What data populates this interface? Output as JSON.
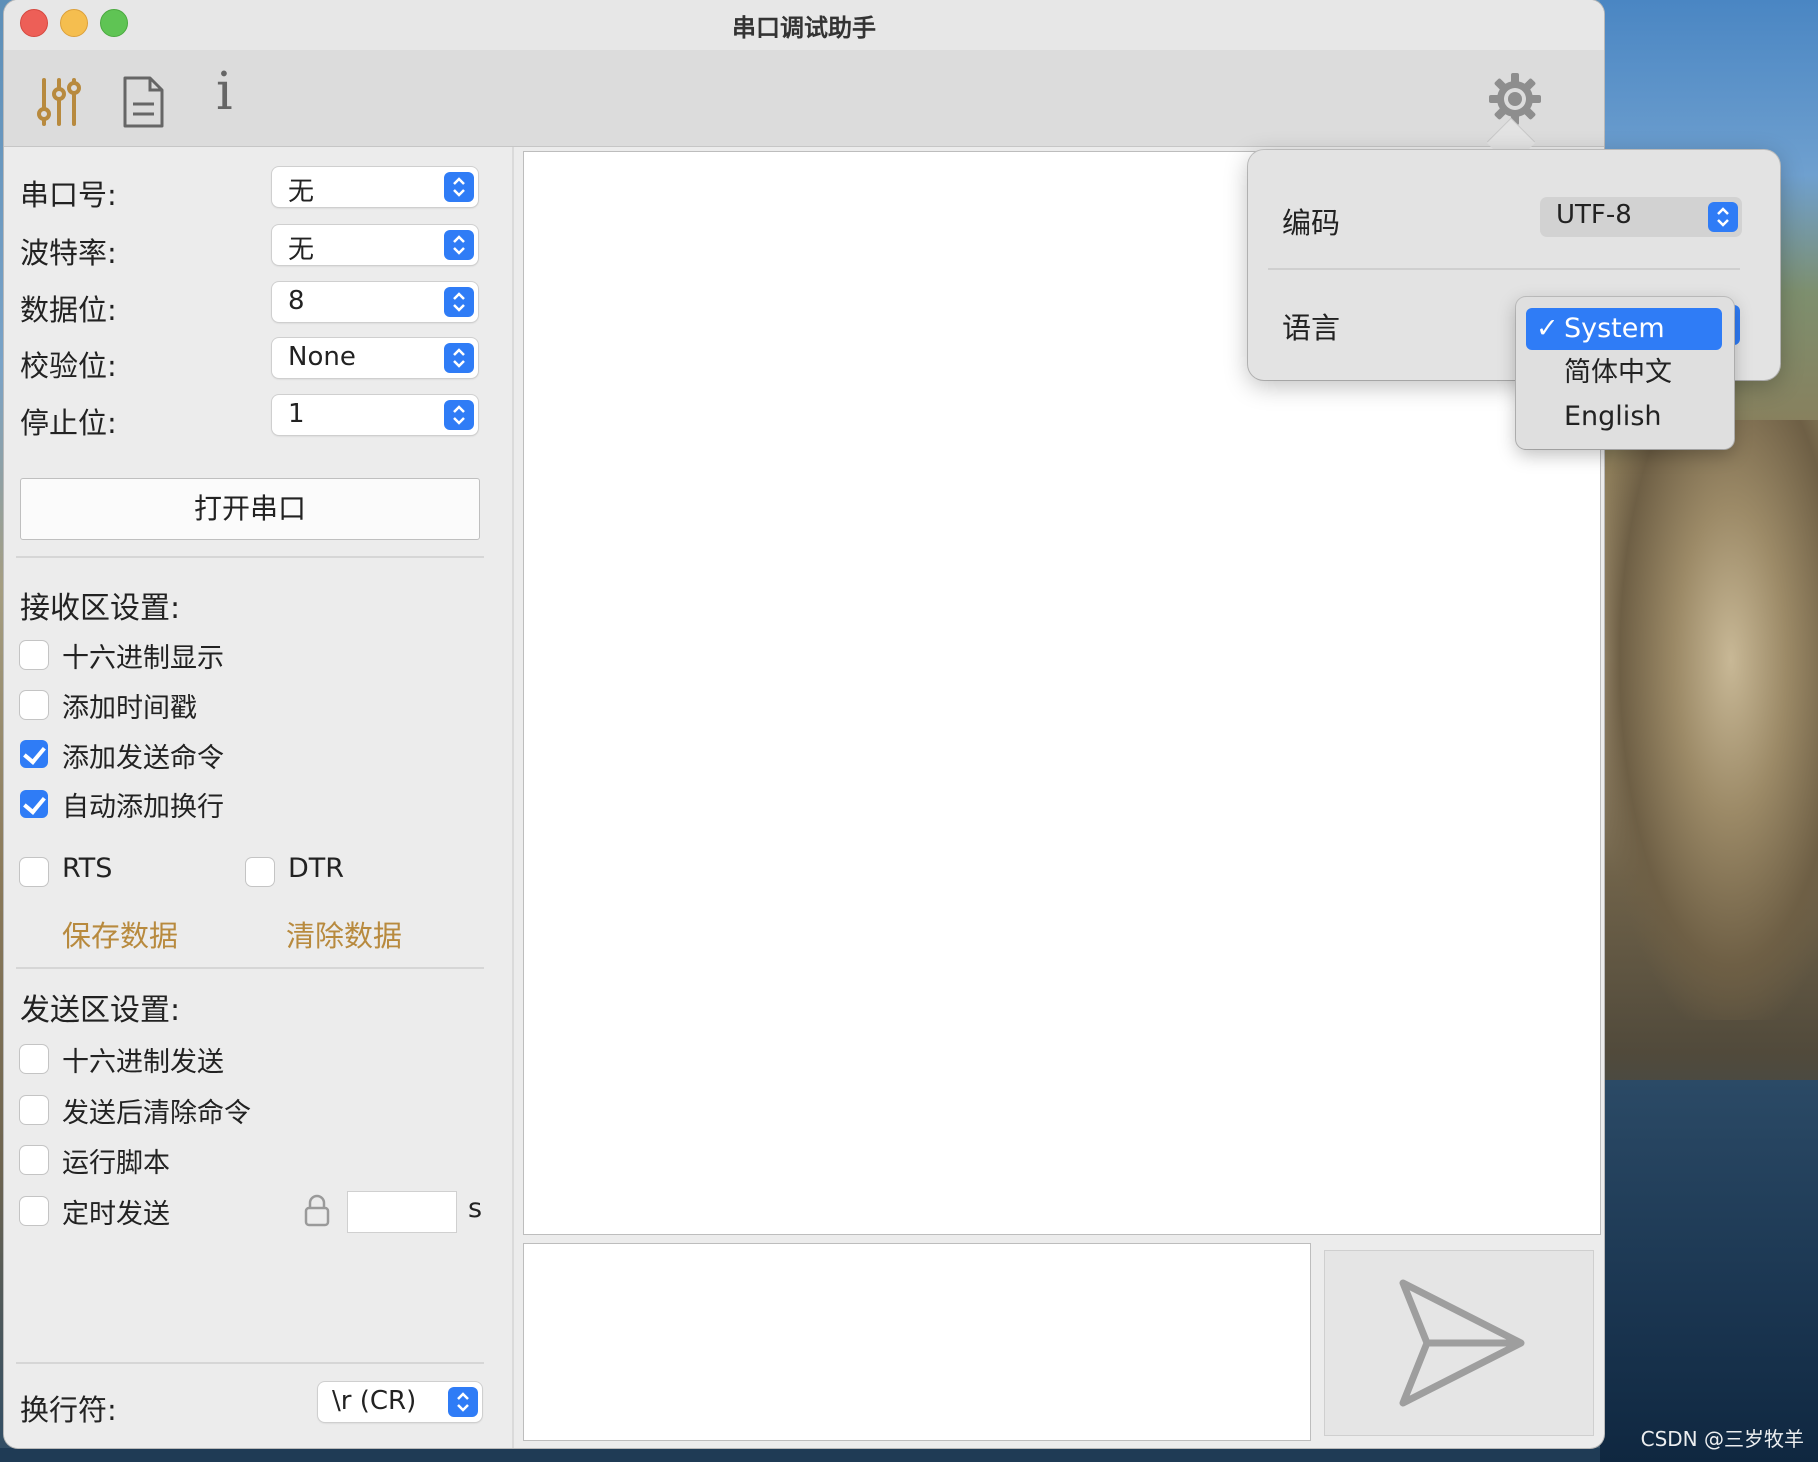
{
  "window": {
    "title": "串口调试助手"
  },
  "toolbar": {
    "settings_icon": "sliders-icon",
    "log_icon": "document-icon",
    "info_label": "i",
    "gear_icon": "gear-icon"
  },
  "serial": {
    "port_label": "串口号:",
    "port_value": "无",
    "baud_label": "波特率:",
    "baud_value": "无",
    "databits_label": "数据位:",
    "databits_value": "8",
    "parity_label": "校验位:",
    "parity_value": "None",
    "stopbits_label": "停止位:",
    "stopbits_value": "1",
    "open_button": "打开串口"
  },
  "receive": {
    "title": "接收区设置:",
    "hex_display": {
      "label": "十六进制显示",
      "checked": false
    },
    "timestamp": {
      "label": "添加时间戳",
      "checked": false
    },
    "echo_command": {
      "label": "添加发送命令",
      "checked": true
    },
    "auto_newline": {
      "label": "自动添加换行",
      "checked": true
    },
    "rts": {
      "label": "RTS",
      "checked": false
    },
    "dtr": {
      "label": "DTR",
      "checked": false
    },
    "save_link": "保存数据",
    "clear_link": "清除数据"
  },
  "send": {
    "title": "发送区设置:",
    "hex_send": {
      "label": "十六进制发送",
      "checked": false
    },
    "clear_after": {
      "label": "发送后清除命令",
      "checked": false
    },
    "run_script": {
      "label": "运行脚本",
      "checked": false
    },
    "timed_send": {
      "label": "定时发送",
      "checked": false
    },
    "interval_value": "",
    "interval_unit": "s",
    "newline_label": "换行符:",
    "newline_value": "\\r  (CR)"
  },
  "popover": {
    "encoding_label": "编码",
    "encoding_value": "UTF-8",
    "language_label": "语言",
    "language_options": [
      "System",
      "简体中文",
      "English"
    ],
    "language_selected": "System"
  },
  "watermark": "CSDN @三岁牧羊",
  "colors": {
    "accent": "#2f7cf6",
    "link": "#b88a3e"
  }
}
